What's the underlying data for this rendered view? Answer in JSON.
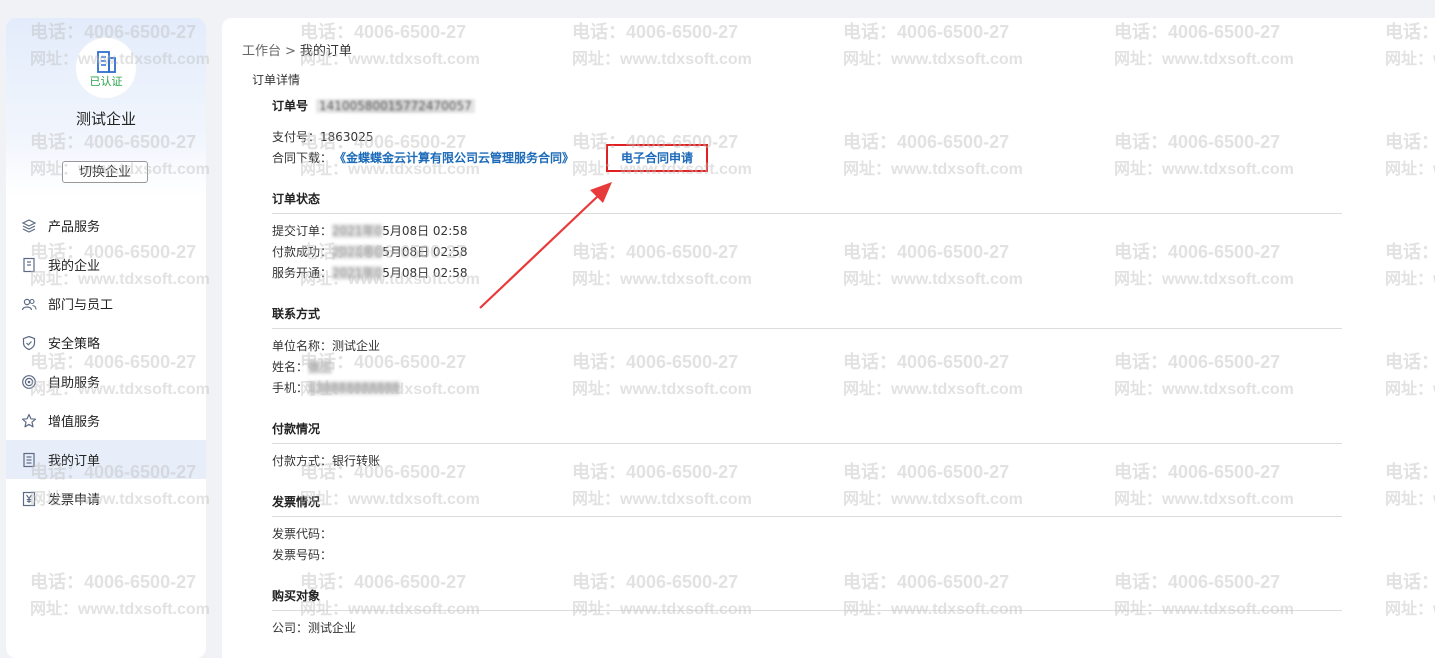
{
  "sidebar": {
    "verified": "已认证",
    "company_name": "测试企业",
    "switch_label": "切换企业",
    "items": [
      {
        "label": "产品服务"
      },
      {
        "label": "我的企业"
      },
      {
        "label": "部门与员工"
      },
      {
        "label": "安全策略"
      },
      {
        "label": "自助服务"
      },
      {
        "label": "增值服务"
      },
      {
        "label": "我的订单"
      },
      {
        "label": "发票申请"
      }
    ]
  },
  "breadcrumb": {
    "home": "工作台",
    "sep": ">",
    "current": "我的订单"
  },
  "detail": {
    "section_title": "订单详情",
    "order_no_label": "订单号",
    "order_no_value": "14100580015772470057",
    "pay_no_label": "支付号：",
    "pay_no_value": "1863025",
    "contract_label": "合同下载：",
    "contract_link": "《金蝶蝶金云计算有限公司云管理服务合同》",
    "econtract_button": "电子合同申请"
  },
  "status": {
    "title": "订单状态",
    "rows": [
      {
        "label": "提交订单：",
        "hidden": "2021年0",
        "value": "5月08日 02:58"
      },
      {
        "label": "付款成功：",
        "hidden": "2021年0",
        "value": "5月08日 02:58"
      },
      {
        "label": "服务开通：",
        "hidden": "2021年0",
        "value": "5月08日 02:58"
      }
    ]
  },
  "contact": {
    "title": "联系方式",
    "unit_label": "单位名称：",
    "unit_value": "测试企业",
    "name_label": "姓名：",
    "name_value": "张三",
    "phone_label": "手机：",
    "phone_value": "138888888888"
  },
  "payment": {
    "title": "付款情况",
    "method_label": "付款方式：",
    "method_value": "银行转账"
  },
  "invoice": {
    "title": "发票情况",
    "code_label": "发票代码：",
    "number_label": "发票号码："
  },
  "purchase": {
    "title": "购买对象",
    "company_label": "公司：",
    "company_value": "测试企业"
  },
  "watermark": {
    "phone": "电话：4006-6500-27",
    "site": "网址：www.tdxsoft.com"
  },
  "colors": {
    "link": "#1d6bb8",
    "highlight": "#e02020",
    "verified": "#2aa24a"
  }
}
